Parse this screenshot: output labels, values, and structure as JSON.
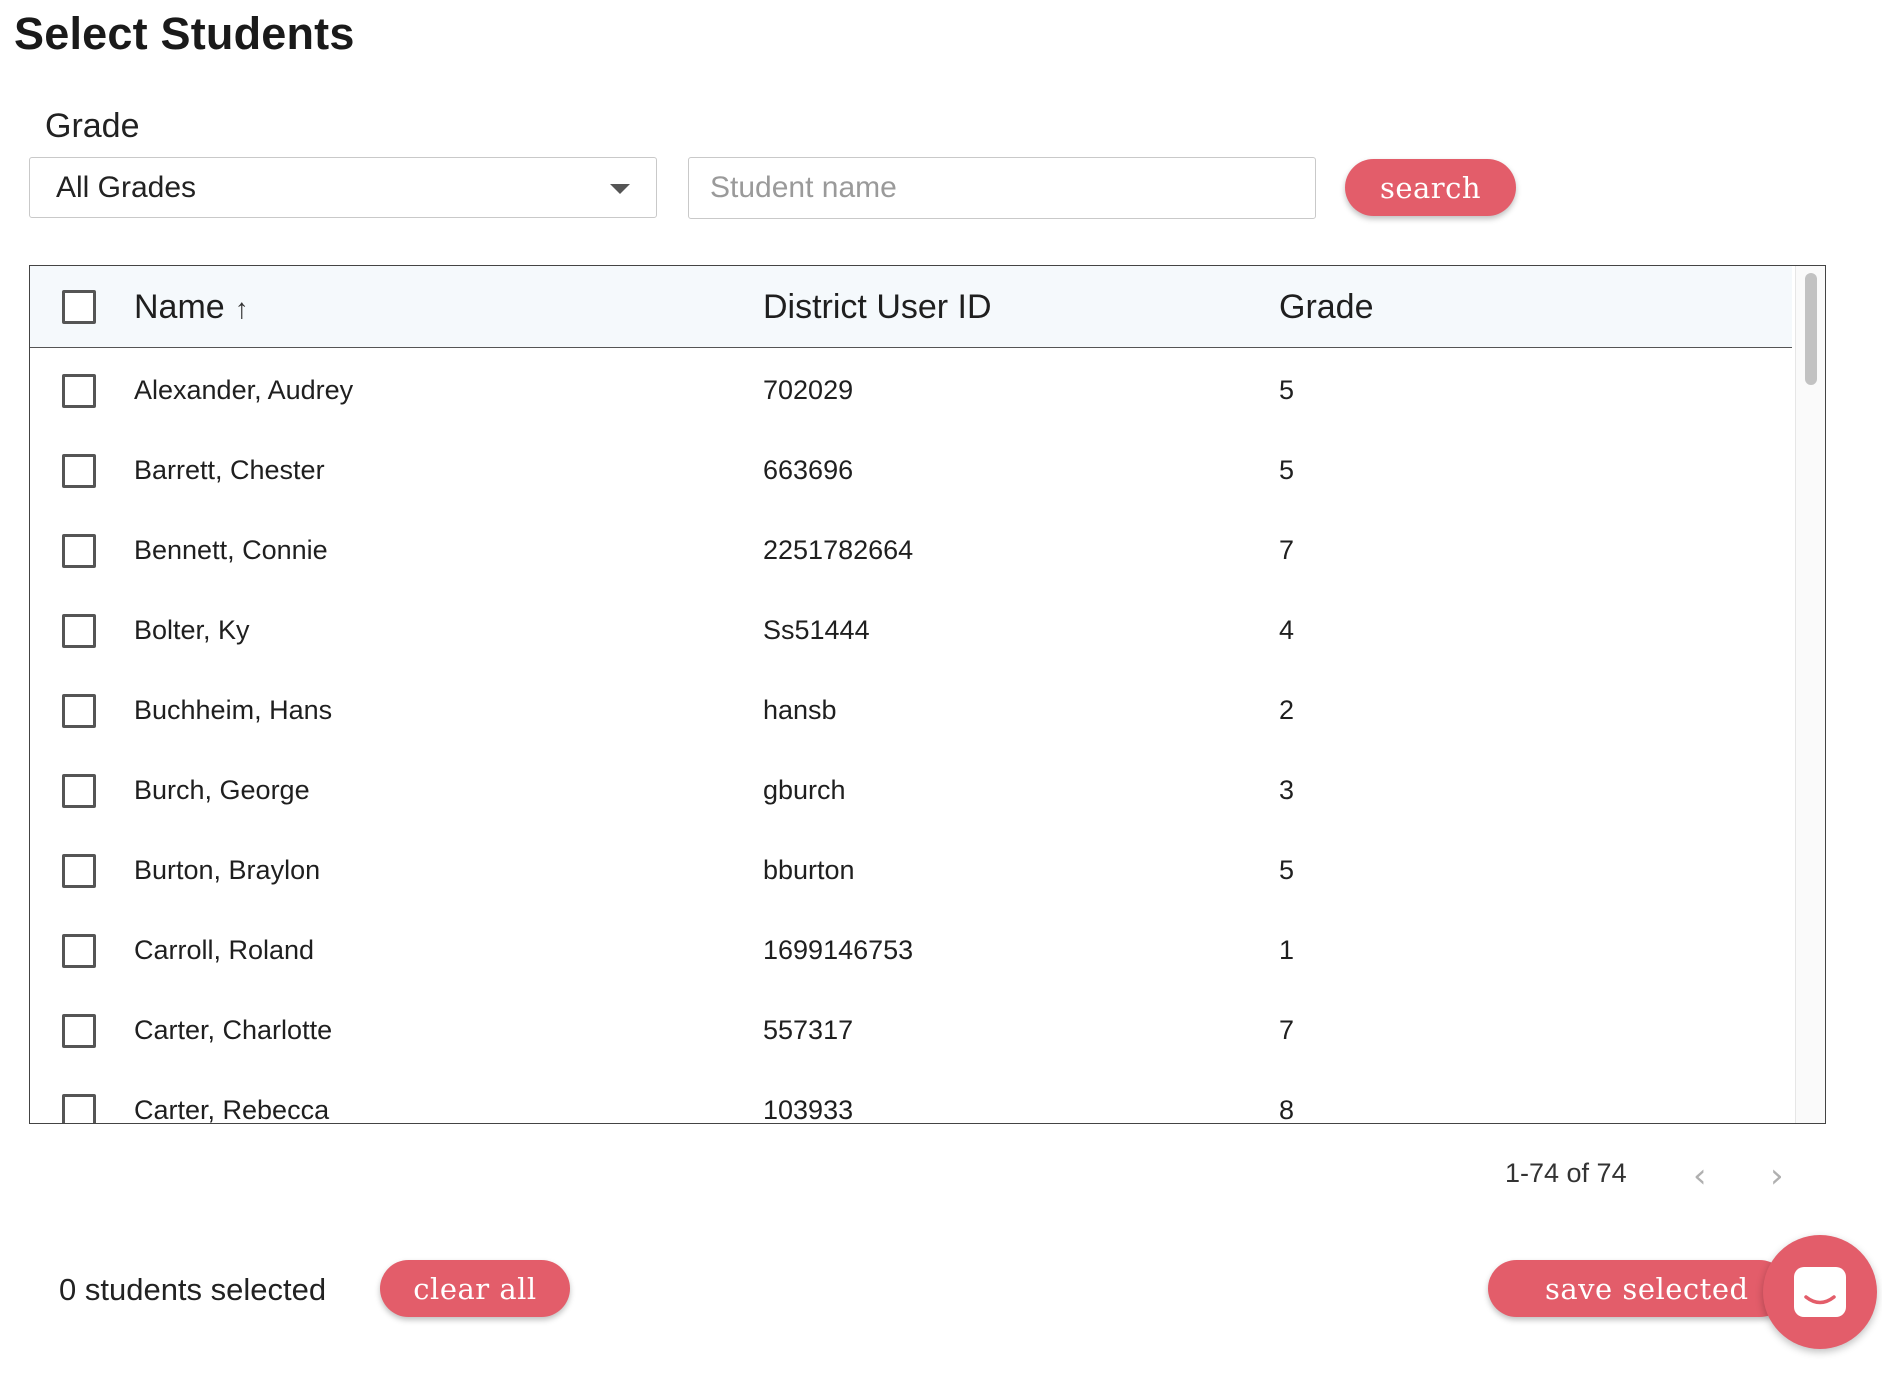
{
  "page": {
    "title": "Select Students"
  },
  "filters": {
    "grade_label": "Grade",
    "grade_selected": "All Grades",
    "search_placeholder": "Student name",
    "search_value": "",
    "search_button": "search"
  },
  "table": {
    "columns": {
      "name": "Name",
      "district_id": "District User ID",
      "grade": "Grade"
    },
    "sort_icon": "arrow-up-icon",
    "rows": [
      {
        "name": "Alexander, Audrey",
        "district_id": "702029",
        "grade": "5"
      },
      {
        "name": "Barrett, Chester",
        "district_id": "663696",
        "grade": "5"
      },
      {
        "name": "Bennett, Connie",
        "district_id": "2251782664",
        "grade": "7"
      },
      {
        "name": "Bolter, Ky",
        "district_id": "Ss51444",
        "grade": "4"
      },
      {
        "name": "Buchheim, Hans",
        "district_id": "hansb",
        "grade": "2"
      },
      {
        "name": "Burch, George",
        "district_id": "gburch",
        "grade": "3"
      },
      {
        "name": "Burton, Braylon",
        "district_id": "bburton",
        "grade": "5"
      },
      {
        "name": "Carroll, Roland",
        "district_id": "1699146753",
        "grade": "1"
      },
      {
        "name": "Carter, Charlotte",
        "district_id": "557317",
        "grade": "7"
      },
      {
        "name": "Carter, Rebecca",
        "district_id": "103933",
        "grade": "8"
      }
    ]
  },
  "pagination": {
    "range_text": "1-74 of 74",
    "prev_icon": "chevron-left-icon",
    "next_icon": "chevron-right-icon"
  },
  "footer": {
    "selected_text": "0 students selected",
    "clear_button": "clear all",
    "save_button": "save selected"
  },
  "colors": {
    "accent": "#e35d6a",
    "header_bg": "#f5f9fc"
  }
}
